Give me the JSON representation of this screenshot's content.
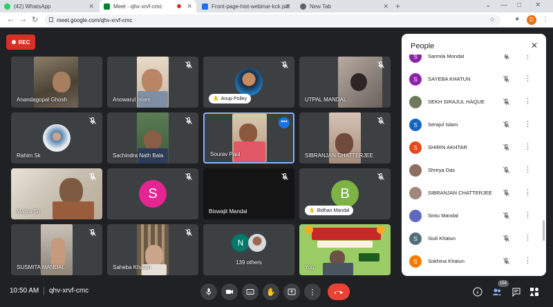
{
  "browser": {
    "tabs": [
      {
        "label": "(42) WhatsApp",
        "color": "#25d366"
      },
      {
        "label": "Meet - qhv-xrvf-cmc",
        "color": "#00832d"
      },
      {
        "label": "Front-page-hist-webinar-kck.pdf",
        "color": "#1a73e8"
      },
      {
        "label": "New Tab",
        "color": "#5f6368"
      }
    ],
    "url": "meet.google.com/qhv-xrvf-cmc",
    "profile_initial": "D"
  },
  "rec_label": "REC",
  "tiles": [
    {
      "name": "Anandagopal Ghosh",
      "type": "video"
    },
    {
      "name": "Anowarul Islam",
      "type": "video"
    },
    {
      "name": "Anup Polley",
      "type": "avatar-photo"
    },
    {
      "name": "UTPAL MANDAL",
      "type": "video"
    },
    {
      "name": "Rahim Sk",
      "type": "avatar-photo"
    },
    {
      "name": "Sachindra Nath Bala",
      "type": "video"
    },
    {
      "name": "Sourav Paul",
      "type": "video"
    },
    {
      "name": "SIBRANJAN CHATTERJEE",
      "type": "video"
    },
    {
      "name": "Maitra Sn",
      "type": "video"
    },
    {
      "name": "",
      "type": "letter",
      "letter": "S",
      "color": "#e52592"
    },
    {
      "name": "Biswajit Mandal",
      "type": "dark"
    },
    {
      "name": "Bidhan Mandal",
      "type": "letter",
      "letter": "B",
      "color": "#7cb342"
    },
    {
      "name": "SUSMITA MANDAL",
      "type": "video"
    },
    {
      "name": "Saheba Khatun",
      "type": "video"
    },
    {
      "name": "139 others",
      "type": "others",
      "letter": "N",
      "color": "#00796b"
    },
    {
      "name": "You",
      "type": "video"
    }
  ],
  "people_panel": {
    "title": "People",
    "items": [
      {
        "name": "Sarmila Mondal",
        "initial": "S",
        "color": "#8e24aa"
      },
      {
        "name": "SAYEBA KHATUN",
        "initial": "S",
        "color": "#8e24aa"
      },
      {
        "name": "SEKH SIRAJUL HAQUE",
        "initial": "",
        "color": "#6d7b5a"
      },
      {
        "name": "Serajul Islam",
        "initial": "S",
        "color": "#1565c0"
      },
      {
        "name": "SHIRIN AKHTAR",
        "initial": "S",
        "color": "#e64a19"
      },
      {
        "name": "Shreya Das",
        "initial": "",
        "color": "#8d6e63"
      },
      {
        "name": "SIBRANJAN CHATTERJEE",
        "initial": "",
        "color": "#a1887f"
      },
      {
        "name": "Sintu Mandal",
        "initial": "",
        "color": "#5c6bc0"
      },
      {
        "name": "Siuli Khatun",
        "initial": "S",
        "color": "#546e7a"
      },
      {
        "name": "Sokhina Khatun",
        "initial": "S",
        "color": "#f57c00"
      }
    ]
  },
  "bottom": {
    "time": "10:50 AM",
    "meeting_code": "qhv-xrvf-cmc",
    "participants_count": "154"
  }
}
